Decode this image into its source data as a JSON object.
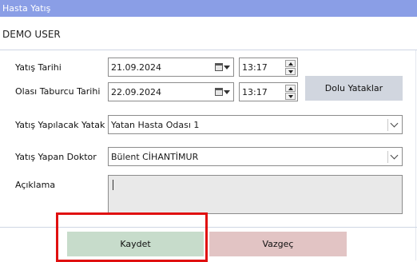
{
  "window": {
    "title": "Hasta Yatış"
  },
  "user": {
    "name": "DEMO USER"
  },
  "form": {
    "admission_date_label": "Yatış Tarihi",
    "admission_date": "21.09.2024",
    "admission_time": "13:17",
    "discharge_date_label": "Olası Taburcu Tarihi",
    "discharge_date": "22.09.2024",
    "discharge_time": "13:17",
    "occupied_beds_button": "Dolu Yataklar",
    "room_label": "Yatış Yapılacak Yatak",
    "room_value": "Yatan Hasta Odası 1",
    "doctor_label": "Yatış Yapan Doktor",
    "doctor_value": "Bülent CİHANTİMUR",
    "note_label": "Açıklama",
    "note_value": ""
  },
  "footer": {
    "save_label": "Kaydet",
    "cancel_label": "Vazgeç"
  },
  "colors": {
    "titlebar": "#8a9ee6",
    "save_button": "#c7dccb",
    "cancel_button": "#e2c4c4",
    "beds_button": "#d1d6df",
    "highlight": "#e01010"
  },
  "icons": {
    "calendar": "calendar-icon",
    "dropdown": "chevron-down-icon",
    "spin_up": "arrow-up-icon",
    "spin_down": "arrow-down-icon"
  }
}
